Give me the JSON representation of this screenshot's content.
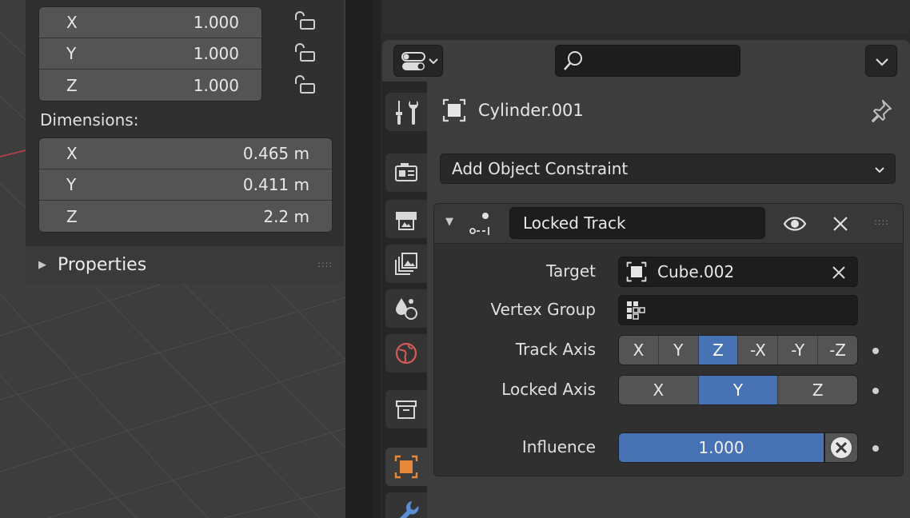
{
  "viewport": {
    "scale_rows": [
      {
        "axis": "X",
        "value": "1.000"
      },
      {
        "axis": "Y",
        "value": "1.000"
      },
      {
        "axis": "Z",
        "value": "1.000"
      }
    ],
    "dimensions_label": "Dimensions:",
    "dimension_rows": [
      {
        "axis": "X",
        "value": "0.465 m"
      },
      {
        "axis": "Y",
        "value": "0.411 m"
      },
      {
        "axis": "Z",
        "value": "2.2 m"
      }
    ],
    "properties_panel_title": "Properties",
    "grip_glyph": "::::"
  },
  "properties_editor": {
    "object_name": "Cylinder.001",
    "add_constraint_label": "Add Object Constraint",
    "constraint": {
      "name": "Locked Track",
      "target_label": "Target",
      "target_value": "Cube.002",
      "vertex_group_label": "Vertex Group",
      "track_axis_label": "Track Axis",
      "track_axis_options": [
        "X",
        "Y",
        "Z",
        "-X",
        "-Y",
        "-Z"
      ],
      "track_axis_selected": "Z",
      "locked_axis_label": "Locked Axis",
      "locked_axis_options": [
        "X",
        "Y",
        "Z"
      ],
      "locked_axis_selected": "Y",
      "influence_label": "Influence",
      "influence_value": "1.000"
    },
    "tabs": [
      "tool",
      "render",
      "output",
      "view-layer",
      "scene",
      "world",
      "collection",
      "object",
      "modifiers"
    ],
    "active_tab": "object"
  },
  "colors": {
    "accent": "#4772b3",
    "object_icon_orange": "#e8883a",
    "world_icon_red": "#d65a5a"
  }
}
